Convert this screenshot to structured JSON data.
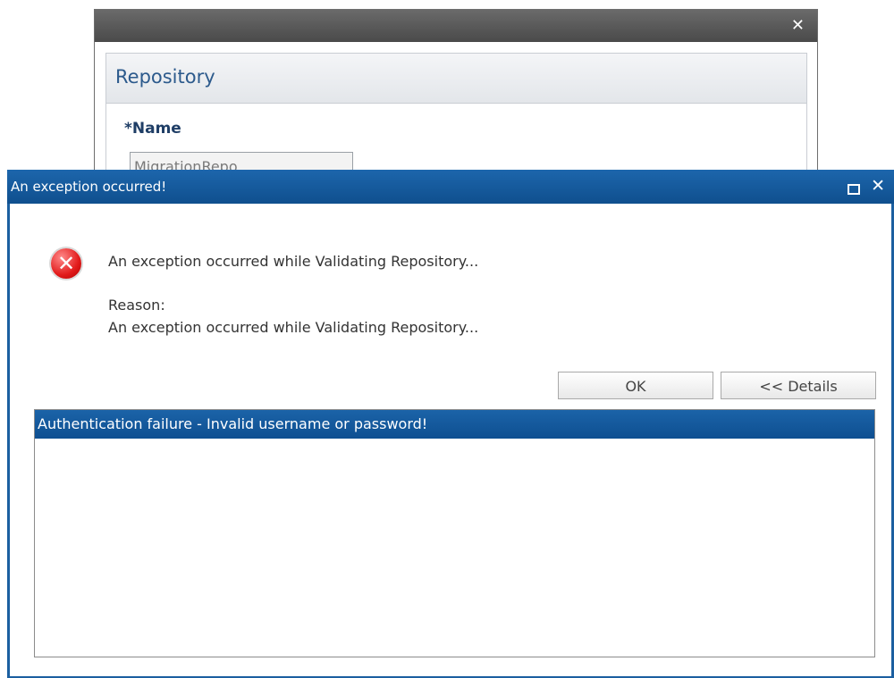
{
  "repository_dialog": {
    "close_glyph": "✕",
    "header_title": "Repository",
    "name_label": "*Name",
    "name_value": "MigrationRepo"
  },
  "exception_dialog": {
    "title": "An exception occurred!",
    "close_glyph": "✕",
    "error_icon": "error-icon",
    "message": "An exception occurred while Validating Repository...",
    "reason_label": "Reason:",
    "reason_text": "An exception occurred while Validating Repository...",
    "ok_label": "OK",
    "details_label": "<< Details",
    "details_items": [
      "Authentication failure - Invalid username or password!"
    ]
  },
  "colors": {
    "title_blue": "#1d66ac",
    "header_text": "#2c5a8c",
    "error_red": "#e21b1b"
  }
}
